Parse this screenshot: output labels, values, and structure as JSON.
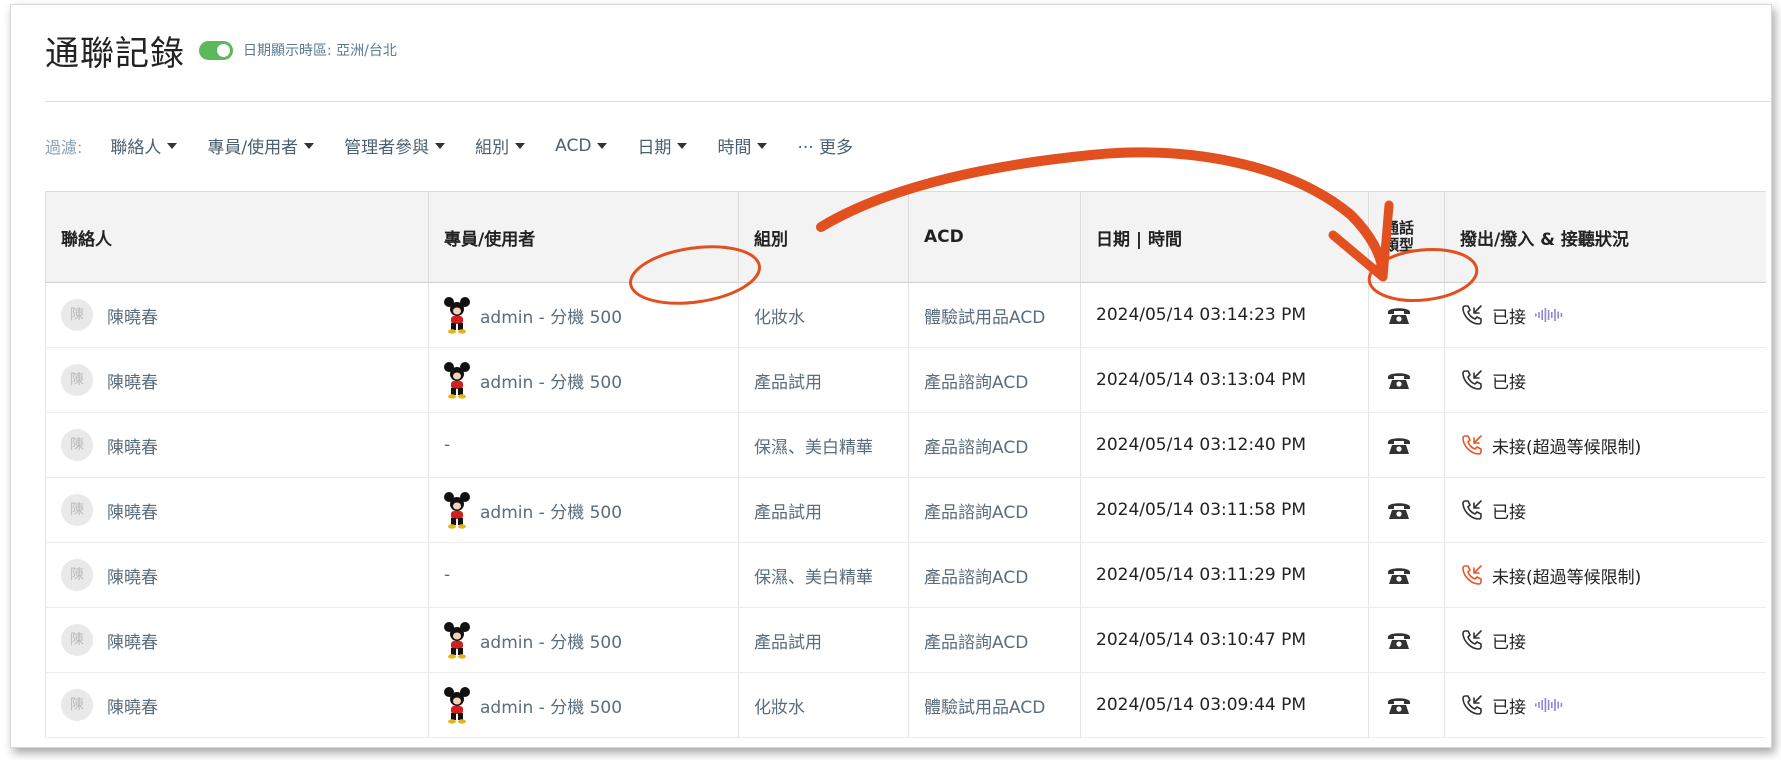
{
  "header": {
    "title": "通聯記錄",
    "timezone_label": "日期顯示時區: 亞洲/台北"
  },
  "filters": {
    "label": "過濾:",
    "items": [
      "聯絡人",
      "專員/使用者",
      "管理者參與",
      "組別",
      "ACD",
      "日期",
      "時間"
    ],
    "more": "··· 更多"
  },
  "table": {
    "headers": {
      "contact": "聯絡人",
      "agent": "專員/使用者",
      "group": "組別",
      "acd": "ACD",
      "datetime": "日期 | 時間",
      "call_type": "通話\n類型",
      "status": "撥出/撥入 & 接聽狀況"
    },
    "rows": [
      {
        "avatar": "陳",
        "contact": "陳曉春",
        "agent": "admin - 分機 500",
        "group": "化妝水",
        "acd": "體驗試用品ACD",
        "datetime": "2024/05/14 03:14:23 PM",
        "status": "已接",
        "answered": true,
        "recording": true
      },
      {
        "avatar": "陳",
        "contact": "陳曉春",
        "agent": "admin - 分機 500",
        "group": "產品試用",
        "acd": "產品諮詢ACD",
        "datetime": "2024/05/14 03:13:04 PM",
        "status": "已接",
        "answered": true,
        "recording": false
      },
      {
        "avatar": "陳",
        "contact": "陳曉春",
        "agent": "-",
        "group": "保濕、美白精華",
        "acd": "產品諮詢ACD",
        "datetime": "2024/05/14 03:12:40 PM",
        "status": "未接(超過等候限制)",
        "answered": false,
        "recording": false
      },
      {
        "avatar": "陳",
        "contact": "陳曉春",
        "agent": "admin - 分機 500",
        "group": "產品試用",
        "acd": "產品諮詢ACD",
        "datetime": "2024/05/14 03:11:58 PM",
        "status": "已接",
        "answered": true,
        "recording": false
      },
      {
        "avatar": "陳",
        "contact": "陳曉春",
        "agent": "-",
        "group": "保濕、美白精華",
        "acd": "產品諮詢ACD",
        "datetime": "2024/05/14 03:11:29 PM",
        "status": "未接(超過等候限制)",
        "answered": false,
        "recording": false
      },
      {
        "avatar": "陳",
        "contact": "陳曉春",
        "agent": "admin - 分機 500",
        "group": "產品試用",
        "acd": "產品諮詢ACD",
        "datetime": "2024/05/14 03:10:47 PM",
        "status": "已接",
        "answered": true,
        "recording": false
      },
      {
        "avatar": "陳",
        "contact": "陳曉春",
        "agent": "admin - 分機 500",
        "group": "化妝水",
        "acd": "體驗試用品ACD",
        "datetime": "2024/05/14 03:09:44 PM",
        "status": "已接",
        "answered": true,
        "recording": true
      }
    ]
  },
  "icons": {
    "deskphone": "deskphone-icon",
    "incoming_answered": "phone-incoming-icon",
    "incoming_missed": "phone-missed-icon",
    "recording": "audio-wave-icon",
    "agent_avatar": "mouse-character-avatar"
  },
  "colors": {
    "toggle": "#5cb85c",
    "missed": "#e8572a",
    "wave": "#8e86d6",
    "annotation": "#e2501f"
  }
}
